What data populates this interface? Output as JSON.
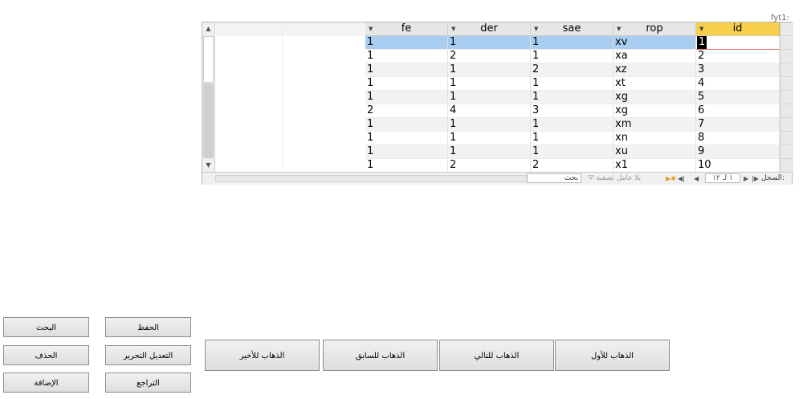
{
  "form_label": "fyt1:",
  "columns": [
    "fe",
    "der",
    "sae",
    "rop",
    "id"
  ],
  "rows": [
    [
      "1",
      "1",
      "1",
      "xv",
      "1"
    ],
    [
      "1",
      "2",
      "1",
      "xa",
      "2"
    ],
    [
      "1",
      "1",
      "2",
      "xz",
      "3"
    ],
    [
      "1",
      "1",
      "1",
      "xt",
      "4"
    ],
    [
      "1",
      "1",
      "1",
      "xg",
      "5"
    ],
    [
      "2",
      "4",
      "3",
      "xg",
      "6"
    ],
    [
      "1",
      "1",
      "1",
      "xm",
      "7"
    ],
    [
      "1",
      "1",
      "1",
      "xn",
      "8"
    ],
    [
      "1",
      "1",
      "1",
      "xu",
      "9"
    ],
    [
      "1",
      "2",
      "2",
      "x1",
      "10"
    ]
  ],
  "navbar": {
    "search_label": "بحث",
    "filter_label": "بلا عامل تصفية",
    "position_text": "١ لـ ١٢",
    "record_label": "السجل:"
  },
  "buttons": {
    "search": "البحث",
    "save": "الحفظ",
    "delete": "الحذف",
    "edit": "التعديل التحرير",
    "add": "الإضافة",
    "undo": "التراجع",
    "go_last": "الذهاب للأخير",
    "go_previous": "الذهاب للسابق",
    "go_next": "الذهاب للتالي",
    "go_first": "الذهاب للأول"
  },
  "icons": {
    "dropdown": "chevron-down-icon",
    "scroll_up": "scroll-up-arrow-icon",
    "scroll_down": "scroll-down-arrow-icon",
    "filter": "filter-icon",
    "nav_first": "nav-first-icon",
    "nav_prev": "nav-prev-icon",
    "nav_next": "nav-next-icon",
    "nav_last": "nav-last-icon",
    "nav_new": "nav-new-icon"
  },
  "colors": {
    "selected_row": "#a7cdf0",
    "active_header": "#f7cf4a",
    "header": "#e6e6e6"
  }
}
